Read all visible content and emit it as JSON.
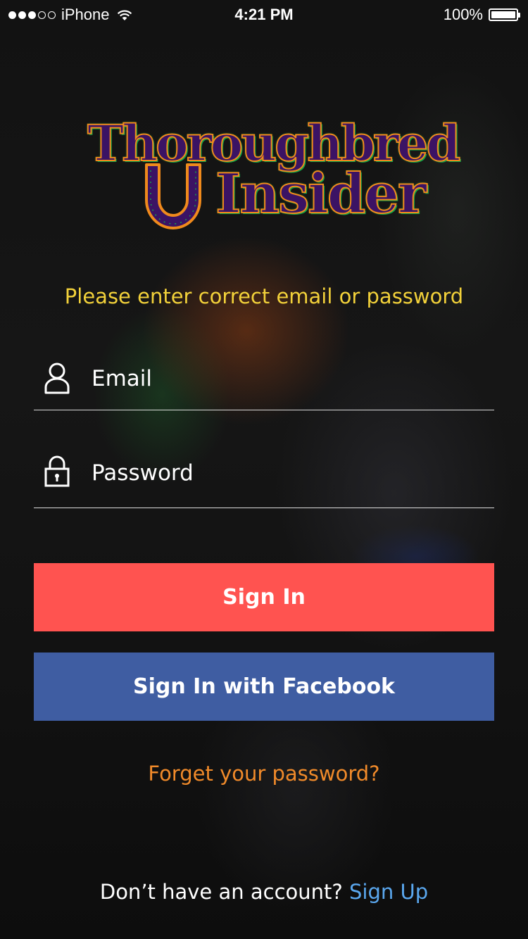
{
  "status_bar": {
    "carrier": "iPhone",
    "time": "4:21 PM",
    "battery": "100%",
    "signal_bars_filled": 3,
    "signal_bars_total": 5
  },
  "logo": {
    "line1": "Thoroughbred",
    "line2": "Insider"
  },
  "login": {
    "error_message": "Please enter correct email or password",
    "email_placeholder": "Email",
    "password_placeholder": "Password",
    "sign_in_label": "Sign In",
    "facebook_label": "Sign In with Facebook",
    "forgot_label": "Forget your password?",
    "no_account_text": "Don’t have an account?",
    "sign_up_label": "Sign Up"
  },
  "colors": {
    "sign_in_button": "#ff5350",
    "facebook_button": "#3f5da2",
    "error_text": "#f2d13a",
    "forgot_link": "#f08a2a",
    "sign_up_link": "#5aa7ee",
    "logo_fill": "#3b1364",
    "logo_outline": "#f08a1c",
    "logo_accent": "#13a64a"
  },
  "icons": {
    "email_field": "user-icon",
    "password_field": "lock-icon",
    "logo_mark": "horseshoe-icon",
    "status_wifi": "wifi-icon",
    "status_battery": "battery-icon"
  }
}
